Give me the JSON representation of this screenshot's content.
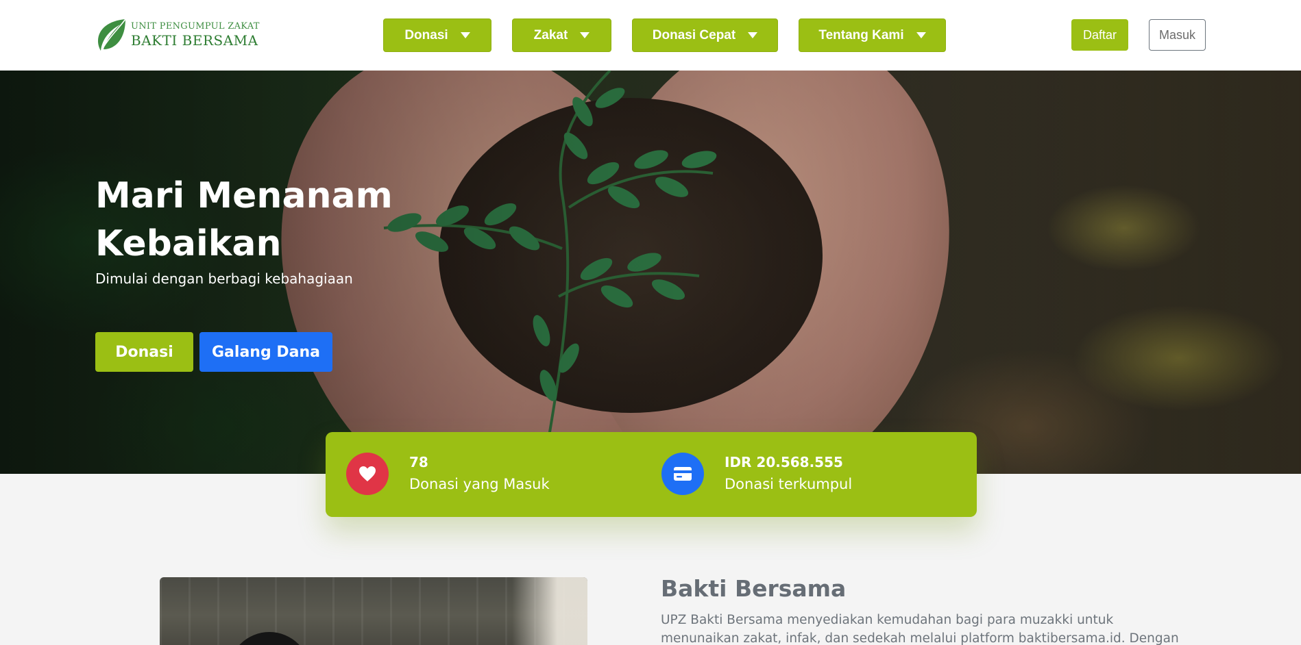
{
  "header": {
    "logo": {
      "line1": "UNIT PENGUMPUL ZAKAT",
      "line2": "BAKTI BERSAMA"
    },
    "nav": [
      {
        "label": "Donasi"
      },
      {
        "label": "Zakat"
      },
      {
        "label": "Donasi Cepat"
      },
      {
        "label": "Tentang Kami"
      }
    ],
    "register_label": "Daftar",
    "login_label": "Masuk"
  },
  "hero": {
    "title": "Mari Menanam Kebaikan",
    "subtitle": "Dimulai dengan berbagi kebahagiaan",
    "donate_label": "Donasi",
    "fundraise_label": "Galang Dana"
  },
  "stats": {
    "donations_count": "78",
    "donations_label": "Donasi yang Masuk",
    "amount": "IDR 20.568.555",
    "amount_label": "Donasi terkumpul"
  },
  "about": {
    "title": "Bakti Bersama",
    "text": "UPZ Bakti Bersama menyediakan kemudahan bagi para muzakki untuk menunaikan zakat, infak, dan sedekah melalui platform baktibersama.id. Dengan layanan terbaik"
  },
  "colors": {
    "brand_green": "#9bbf14",
    "accent_blue": "#1e6ff5",
    "heart_red": "#e03546"
  }
}
